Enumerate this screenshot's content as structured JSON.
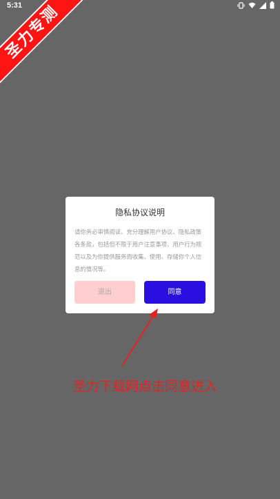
{
  "status_bar": {
    "time": "5:31",
    "icons": [
      "vibrate-icon",
      "wifi-icon",
      "signal-icon",
      "battery-icon"
    ]
  },
  "ribbon": {
    "text": "圣力专测"
  },
  "dialog": {
    "title": "隐私协议说明",
    "body": "请你务必审慎阅读、充分理解用户协议、隐私政策各条款，包括但不限于用户注意事项、用户行为规范以及为你提供服务而收集、使用、存储你个人信息的情况等。",
    "exit_label": "退出",
    "agree_label": "同意"
  },
  "annotation": {
    "caption": "圣力下载网点击同意进入"
  },
  "colors": {
    "background": "#666666",
    "ribbon": "#ff1414",
    "agree_button": "#2b0fe0",
    "exit_button": "#ffcfcf",
    "annotation": "#e52222"
  }
}
